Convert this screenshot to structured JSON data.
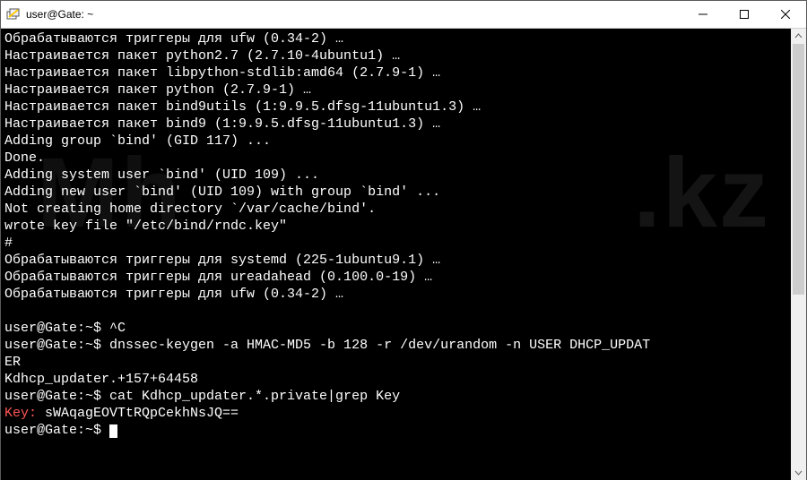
{
  "window": {
    "title": "user@Gate: ~"
  },
  "watermark_right": ".kz",
  "watermark_left": "Mh",
  "terminal": {
    "lines": [
      {
        "t": "Обрабатываются триггеры для ufw (0.34-2) …"
      },
      {
        "t": "Настраивается пакет python2.7 (2.7.10-4ubuntu1) …"
      },
      {
        "t": "Настраивается пакет libpython-stdlib:amd64 (2.7.9-1) …"
      },
      {
        "t": "Настраивается пакет python (2.7.9-1) …"
      },
      {
        "t": "Настраивается пакет bind9utils (1:9.9.5.dfsg-11ubuntu1.3) …"
      },
      {
        "t": "Настраивается пакет bind9 (1:9.9.5.dfsg-11ubuntu1.3) …"
      },
      {
        "t": "Adding group `bind' (GID 117) ..."
      },
      {
        "t": "Done."
      },
      {
        "t": "Adding system user `bind' (UID 109) ..."
      },
      {
        "t": "Adding new user `bind' (UID 109) with group `bind' ..."
      },
      {
        "t": "Not creating home directory `/var/cache/bind'."
      },
      {
        "t": "wrote key file \"/etc/bind/rndc.key\""
      },
      {
        "t": "#"
      },
      {
        "t": "Обрабатываются триггеры для systemd (225-1ubuntu9.1) …"
      },
      {
        "t": "Обрабатываются триггеры для ureadahead (0.100.0-19) …"
      },
      {
        "t": "Обрабатываются триггеры для ufw (0.34-2) …"
      },
      {
        "t": ""
      },
      {
        "t": "user@Gate:~$ ^C"
      },
      {
        "t": "user@Gate:~$ dnssec-keygen -a HMAC-MD5 -b 128 -r /dev/urandom -n USER DHCP_UPDAT"
      },
      {
        "t": "ER"
      },
      {
        "t": "Kdhcp_updater.+157+64458"
      },
      {
        "t": "user@Gate:~$ cat Kdhcp_updater.*.private|grep Key"
      },
      {
        "key_label": "Key:",
        "key_value": " sWAqagEOVTtRQpCekhNsJQ=="
      },
      {
        "prompt": "user@Gate:~$ "
      }
    ]
  }
}
